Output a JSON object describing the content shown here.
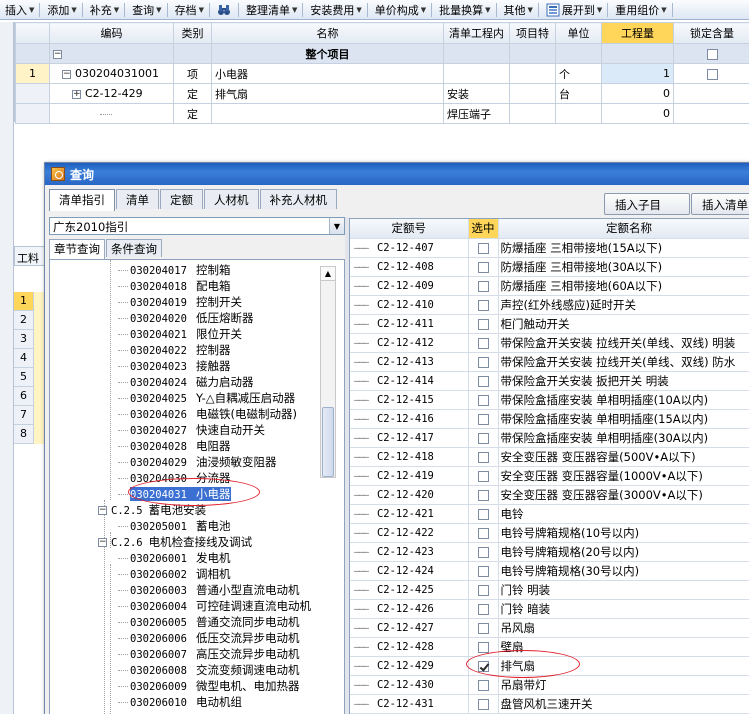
{
  "toolbar": {
    "items": [
      {
        "label": "插入",
        "dropdown": true
      },
      {
        "label": "添加",
        "dropdown": true
      },
      {
        "label": "补充",
        "dropdown": true
      },
      {
        "label": "查询",
        "dropdown": true
      },
      {
        "label": "存档",
        "dropdown": true
      },
      {
        "label": "",
        "icon": "binoculars-icon",
        "dropdown": false
      },
      {
        "label": "整理清单",
        "dropdown": true
      },
      {
        "label": "安装费用",
        "dropdown": true
      },
      {
        "label": "单价构成",
        "dropdown": true
      },
      {
        "label": "批量换算",
        "dropdown": true
      },
      {
        "label": "其他",
        "dropdown": true
      },
      {
        "label": "展开到",
        "icon": "expand-icon",
        "dropdown": true
      },
      {
        "label": "重用组价",
        "dropdown": true
      }
    ]
  },
  "main_grid": {
    "headers": [
      "编码",
      "类别",
      "名称",
      "清单工程内",
      "项目特",
      "单位",
      "工程量",
      "锁定含量"
    ],
    "project_row": {
      "label": "整个项目"
    },
    "rows": [
      {
        "rownum": "1",
        "code": "030204031001",
        "type": "项",
        "name": "小电器",
        "content": "",
        "feature": "",
        "unit": "个",
        "qty": "1",
        "tree": "−"
      },
      {
        "rownum": "",
        "code": "C2-12-429",
        "type": "定",
        "name": "排气扇",
        "content": "安装",
        "feature": "",
        "unit": "台",
        "qty": "0",
        "tree": "+"
      },
      {
        "rownum": "",
        "code": "",
        "type": "定",
        "name": "",
        "content": "焊压端子",
        "feature": "",
        "unit": "",
        "qty": "0",
        "tree": ""
      }
    ]
  },
  "sub_grid": {
    "tab_label": "工料",
    "row_numbers": [
      "1",
      "2",
      "3",
      "4",
      "5",
      "6",
      "7",
      "8"
    ]
  },
  "dialog": {
    "title": "查询",
    "tabs": [
      "清单指引",
      "清单",
      "定额",
      "人材机",
      "补充人材机"
    ],
    "active_tab": "清单指引",
    "insert_child_button": "插入子目",
    "insert_list_button": "插入清单(I",
    "combo_value": "广东2010指引",
    "subtabs": [
      "章节查询",
      "条件查询"
    ],
    "tree": [
      {
        "code": "030204017",
        "name": "控制箱",
        "level": 3
      },
      {
        "code": "030204018",
        "name": "配电箱",
        "level": 3
      },
      {
        "code": "030204019",
        "name": "控制开关",
        "level": 3
      },
      {
        "code": "030204020",
        "name": "低压熔断器",
        "level": 3
      },
      {
        "code": "030204021",
        "name": "限位开关",
        "level": 3
      },
      {
        "code": "030204022",
        "name": "控制器",
        "level": 3
      },
      {
        "code": "030204023",
        "name": "接触器",
        "level": 3
      },
      {
        "code": "030204024",
        "name": "磁力启动器",
        "level": 3
      },
      {
        "code": "030204025",
        "name": "Y-△自耦减压启动器",
        "level": 3
      },
      {
        "code": "030204026",
        "name": "电磁铁(电磁制动器)",
        "level": 3
      },
      {
        "code": "030204027",
        "name": "快速自动开关",
        "level": 3
      },
      {
        "code": "030204028",
        "name": "电阻器",
        "level": 3
      },
      {
        "code": "030204029",
        "name": "油浸频敏变阻器",
        "level": 3
      },
      {
        "code": "030204030",
        "name": "分流器",
        "level": 3
      },
      {
        "code": "030204031",
        "name": "小电器",
        "level": 3,
        "selected": true
      },
      {
        "code": "C.2.5",
        "name": "蓄电池安装",
        "level": 2
      },
      {
        "code": "030205001",
        "name": "蓄电池",
        "level": 3
      },
      {
        "code": "C.2.6",
        "name": "电机检查接线及调试",
        "level": 2
      },
      {
        "code": "030206001",
        "name": "发电机",
        "level": 3
      },
      {
        "code": "030206002",
        "name": "调相机",
        "level": 3
      },
      {
        "code": "030206003",
        "name": "普通小型直流电动机",
        "level": 3
      },
      {
        "code": "030206004",
        "name": "可控硅调速直流电动机",
        "level": 3
      },
      {
        "code": "030206005",
        "name": "普通交流同步电动机",
        "level": 3
      },
      {
        "code": "030206006",
        "name": "低压交流异步电动机",
        "level": 3
      },
      {
        "code": "030206007",
        "name": "高压交流异步电动机",
        "level": 3
      },
      {
        "code": "030206008",
        "name": "交流变频调速电动机",
        "level": 3
      },
      {
        "code": "030206009",
        "name": "微型电机、电加热器",
        "level": 3
      },
      {
        "code": "030206010",
        "name": "电动机组",
        "level": 3
      }
    ],
    "right_grid": {
      "headers": [
        "定额号",
        "选中",
        "定额名称"
      ],
      "rows": [
        {
          "code": "C2-12-407",
          "checked": false,
          "name": "防爆插座 三相带接地(15A以下)"
        },
        {
          "code": "C2-12-408",
          "checked": false,
          "name": "防爆插座 三相带接地(30A以下)"
        },
        {
          "code": "C2-12-409",
          "checked": false,
          "name": "防爆插座 三相带接地(60A以下)"
        },
        {
          "code": "C2-12-410",
          "checked": false,
          "name": "声控(红外线感应)延时开关"
        },
        {
          "code": "C2-12-411",
          "checked": false,
          "name": "柜门触动开关"
        },
        {
          "code": "C2-12-412",
          "checked": false,
          "name": "带保险盒开关安装 拉线开关(单线、双线) 明装"
        },
        {
          "code": "C2-12-413",
          "checked": false,
          "name": "带保险盒开关安装 拉线开关(单线、双线) 防水"
        },
        {
          "code": "C2-12-414",
          "checked": false,
          "name": "带保险盒开关安装 扳把开关 明装"
        },
        {
          "code": "C2-12-415",
          "checked": false,
          "name": "带保险盒插座安装 单相明插座(10A以内)"
        },
        {
          "code": "C2-12-416",
          "checked": false,
          "name": "带保险盒插座安装 单相明插座(15A以内)"
        },
        {
          "code": "C2-12-417",
          "checked": false,
          "name": "带保险盒插座安装 单相明插座(30A以内)"
        },
        {
          "code": "C2-12-418",
          "checked": false,
          "name": "安全变压器 变压器容量(500V•A以下)"
        },
        {
          "code": "C2-12-419",
          "checked": false,
          "name": "安全变压器 变压器容量(1000V•A以下)"
        },
        {
          "code": "C2-12-420",
          "checked": false,
          "name": "安全变压器 变压器容量(3000V•A以下)"
        },
        {
          "code": "C2-12-421",
          "checked": false,
          "name": "电铃"
        },
        {
          "code": "C2-12-422",
          "checked": false,
          "name": "电铃号牌箱规格(10号以内)"
        },
        {
          "code": "C2-12-423",
          "checked": false,
          "name": "电铃号牌箱规格(20号以内)"
        },
        {
          "code": "C2-12-424",
          "checked": false,
          "name": "电铃号牌箱规格(30号以内)"
        },
        {
          "code": "C2-12-425",
          "checked": false,
          "name": "门铃 明装"
        },
        {
          "code": "C2-12-426",
          "checked": false,
          "name": "门铃 暗装"
        },
        {
          "code": "C2-12-427",
          "checked": false,
          "name": "吊风扇"
        },
        {
          "code": "C2-12-428",
          "checked": false,
          "name": "壁扇"
        },
        {
          "code": "C2-12-429",
          "checked": true,
          "name": "排气扇"
        },
        {
          "code": "C2-12-430",
          "checked": false,
          "name": "吊扇带灯"
        },
        {
          "code": "C2-12-431",
          "checked": false,
          "name": "盘管风机三速开关"
        }
      ]
    }
  },
  "colors": {
    "highlight_yellow": "#ffd65a",
    "selection_blue": "#3b6fd1",
    "annotation_red": "#e0202a"
  }
}
